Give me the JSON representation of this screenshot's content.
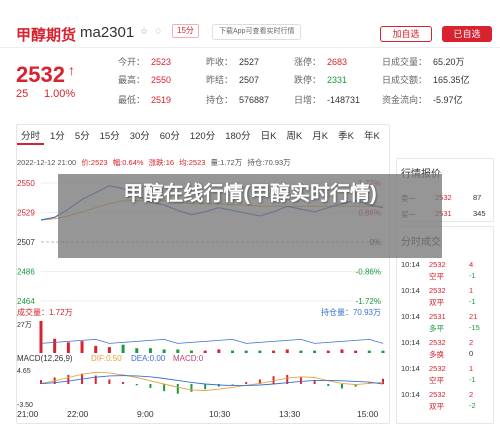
{
  "header": {
    "title": "甲醇期货",
    "code": "ma2301",
    "icons": [
      "star-icon",
      "bell-icon"
    ],
    "badge": "15分",
    "download_label": "下载App可查看实时行情",
    "add_button": "加自选",
    "added_button": "已自选"
  },
  "quote": {
    "price": "2532",
    "arrow": "↑",
    "change": "25",
    "change_pct": "1.00%",
    "stats": [
      {
        "label": "今开：",
        "value": "2523",
        "color": "red"
      },
      {
        "label": "昨收：",
        "value": "2527",
        "color": "dark"
      },
      {
        "label": "涨停：",
        "value": "2683",
        "color": "red"
      },
      {
        "label": "日成交量：",
        "value": "65.20万",
        "color": "dark"
      },
      {
        "label": "最高：",
        "value": "2550",
        "color": "red"
      },
      {
        "label": "昨结：",
        "value": "2507",
        "color": "dark"
      },
      {
        "label": "跌停：",
        "value": "2331",
        "color": "green"
      },
      {
        "label": "日成交额：",
        "value": "165.35亿",
        "color": "dark"
      },
      {
        "label": "最低：",
        "value": "2519",
        "color": "red"
      },
      {
        "label": "持仓：",
        "value": "576887",
        "color": "dark"
      },
      {
        "label": "日增：",
        "value": "-148731",
        "color": "dark"
      },
      {
        "label": "资金流向：",
        "value": "-5.97亿",
        "color": "dark"
      }
    ]
  },
  "chart": {
    "tabs": [
      "分时",
      "1分",
      "5分",
      "15分",
      "30分",
      "60分",
      "120分",
      "180分",
      "日K",
      "周K",
      "月K",
      "季K",
      "年K"
    ],
    "info": {
      "datetime": "2022-12-12 21:00",
      "price_label": "价:2523",
      "pct_label": "幅:0.64%",
      "chg_label": "涨跌:16",
      "avg_label": "均:2523",
      "vol_label": "量:1.72万",
      "oi_label": "持仓:70.93万"
    },
    "y_labels_left": [
      "2550",
      "2529",
      "2507",
      "2486",
      "2464"
    ],
    "y_labels_right": [
      "1.72%",
      "0.86%",
      "0%",
      "-0.86%",
      "-1.72%"
    ],
    "volume_label": "成交量：1.72万",
    "oi_label": "持仓量：70.93万",
    "vol_axis": "27万",
    "macd_label": "MACD(12,26,9)",
    "dif_label": "DIF:0.50",
    "dea_label": "DEA:0.00",
    "macd_value_label": "MACD:0",
    "macd_axis_top": "4.65",
    "macd_axis_bottom": "-3.50",
    "x_labels": [
      "21:00",
      "22:00",
      "9:00",
      "10:30",
      "13:30",
      "15:00"
    ]
  },
  "chart_data": {
    "type": "line",
    "title": "",
    "xlabel": "",
    "ylabel": "",
    "ylim": [
      2464,
      2550
    ],
    "series": [
      {
        "name": "",
        "values": [
          2523,
          2525,
          2531,
          2538,
          2543,
          2548,
          2546,
          2541,
          2536,
          2534,
          2530,
          2527,
          2529,
          2532,
          2530,
          2528,
          2526,
          2529,
          2533,
          2531,
          2529,
          2532,
          2535,
          2537,
          2534,
          2532
        ]
      },
      {
        "name": "",
        "values": [
          2523,
          2524,
          2526,
          2529,
          2532,
          2535,
          2537,
          2537,
          2537,
          2537,
          2536,
          2535,
          2535,
          2535,
          2534,
          2534,
          2533,
          2533,
          2533,
          2533,
          2533,
          2533,
          2533,
          2533,
          2533,
          2533
        ]
      }
    ],
    "volume": [
      27,
      12,
      9,
      10,
      6,
      5,
      7,
      4,
      4,
      3,
      3,
      2,
      2,
      3,
      2,
      2,
      2,
      2,
      3,
      2,
      2,
      2,
      3,
      2,
      2,
      2
    ],
    "macd": [
      1.2,
      2.0,
      2.8,
      3.2,
      2.6,
      1.4,
      0.6,
      -0.4,
      -1.2,
      -2.2,
      -3.0,
      -2.4,
      -1.6,
      -0.8,
      -0.2,
      0.6,
      1.4,
      2.4,
      2.8,
      2.0,
      1.2,
      -0.6,
      -1.4,
      -0.8,
      0.4,
      1.6
    ],
    "dif": [
      0.2,
      1.0,
      2.0,
      3.0,
      3.6,
      3.4,
      2.8,
      2.0,
      1.0,
      0.0,
      -1.0,
      -1.8,
      -2.0,
      -1.6,
      -1.0,
      -0.4,
      0.2,
      1.0,
      1.8,
      2.2,
      2.0,
      1.0,
      0.2,
      -0.2,
      0.2,
      0.5
    ],
    "dea": [
      0.1,
      0.4,
      0.9,
      1.5,
      2.1,
      2.5,
      2.6,
      2.5,
      2.2,
      1.7,
      1.1,
      0.5,
      0.0,
      -0.3,
      -0.5,
      -0.5,
      -0.3,
      0.0,
      0.4,
      0.8,
      1.1,
      1.1,
      1.0,
      0.8,
      0.6,
      0.0
    ]
  },
  "trade_panel": {
    "title": "行情报价",
    "rows": [
      {
        "label": "卖一",
        "price": "2532",
        "vol": "87"
      },
      {
        "label": "买一",
        "price": "2531",
        "vol": "345"
      }
    ]
  },
  "ticks_panel": {
    "title": "分时成交",
    "rows": [
      {
        "time": "10:14",
        "price": "2532",
        "vol": "4",
        "kind": "空平",
        "delta": "-1",
        "pcolor": "red",
        "kcolor": "red",
        "dcolor": "green"
      },
      {
        "time": "10:14",
        "price": "2532",
        "vol": "1",
        "kind": "双平",
        "delta": "-1",
        "pcolor": "red",
        "kcolor": "red",
        "dcolor": "green"
      },
      {
        "time": "10:14",
        "price": "2531",
        "vol": "21",
        "kind": "多平",
        "delta": "-15",
        "pcolor": "red",
        "kcolor": "green",
        "dcolor": "green"
      },
      {
        "time": "10:14",
        "price": "2532",
        "vol": "2",
        "kind": "多换",
        "delta": "0",
        "pcolor": "red",
        "kcolor": "red",
        "dcolor": "dark"
      },
      {
        "time": "10:14",
        "price": "2532",
        "vol": "1",
        "kind": "空平",
        "delta": "-1",
        "pcolor": "red",
        "kcolor": "red",
        "dcolor": "green"
      },
      {
        "time": "10:14",
        "price": "2532",
        "vol": "2",
        "kind": "双平",
        "delta": "-2",
        "pcolor": "red",
        "kcolor": "red",
        "dcolor": "green"
      }
    ]
  },
  "overlay": {
    "text": "甲醇在线行情(甲醇实时行情)"
  },
  "colors": {
    "up": "#d8222f",
    "down": "#1a9a3e",
    "price_line": "#3b6fd4",
    "avg_line": "#e6a23c",
    "dif": "#e6a23c",
    "dea": "#3b6fd4"
  }
}
